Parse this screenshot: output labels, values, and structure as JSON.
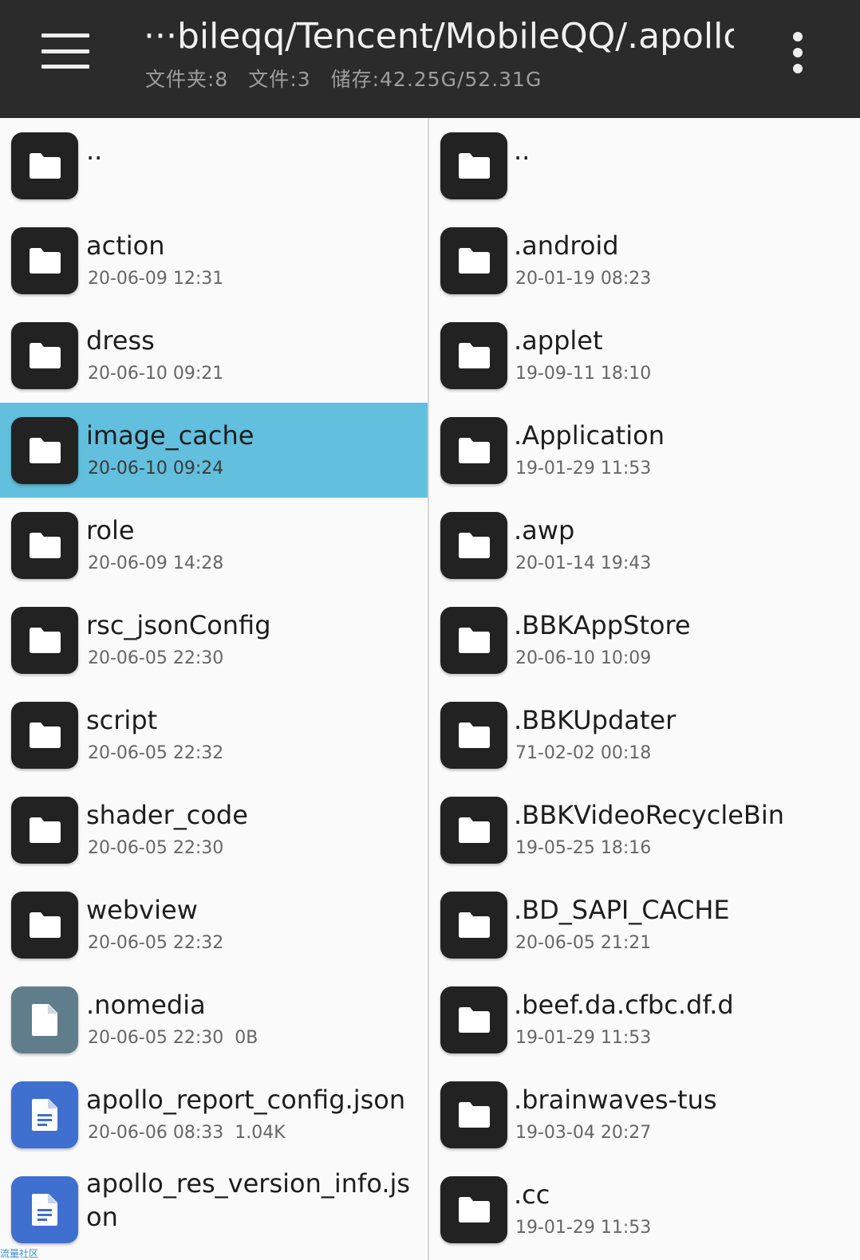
{
  "header": {
    "path": "···bileqq/Tencent/MobileQQ/.apollo/",
    "folders_label": "文件夹:8",
    "files_label": "文件:3",
    "storage_label": "储存:42.25G/52.31G"
  },
  "left_pane": {
    "items": [
      {
        "name": "..",
        "date": "",
        "size": "",
        "kind": "folder"
      },
      {
        "name": "action",
        "date": "20-06-09 12:31",
        "size": "",
        "kind": "folder"
      },
      {
        "name": "dress",
        "date": "20-06-10 09:21",
        "size": "",
        "kind": "folder"
      },
      {
        "name": "image_cache",
        "date": "20-06-10 09:24",
        "size": "",
        "kind": "folder",
        "selected": true
      },
      {
        "name": "role",
        "date": "20-06-09 14:28",
        "size": "",
        "kind": "folder"
      },
      {
        "name": "rsc_jsonConfig",
        "date": "20-06-05 22:30",
        "size": "",
        "kind": "folder"
      },
      {
        "name": "script",
        "date": "20-06-05 22:32",
        "size": "",
        "kind": "folder"
      },
      {
        "name": "shader_code",
        "date": "20-06-05 22:30",
        "size": "",
        "kind": "folder"
      },
      {
        "name": "webview",
        "date": "20-06-05 22:32",
        "size": "",
        "kind": "folder"
      },
      {
        "name": ".nomedia",
        "date": "20-06-05 22:30",
        "size": "0B",
        "kind": "file"
      },
      {
        "name": "apollo_report_config.json",
        "date": "20-06-06 08:33",
        "size": "1.04K",
        "kind": "doc"
      },
      {
        "name": "apollo_res_version_info.json",
        "date": "",
        "size": "",
        "kind": "doc"
      }
    ]
  },
  "right_pane": {
    "items": [
      {
        "name": "..",
        "date": "",
        "kind": "folder"
      },
      {
        "name": ".android",
        "date": "20-01-19 08:23",
        "kind": "folder"
      },
      {
        "name": ".applet",
        "date": "19-09-11 18:10",
        "kind": "folder"
      },
      {
        "name": ".Application",
        "date": "19-01-29 11:53",
        "kind": "folder"
      },
      {
        "name": ".awp",
        "date": "20-01-14 19:43",
        "kind": "folder"
      },
      {
        "name": ".BBKAppStore",
        "date": "20-06-10 10:09",
        "kind": "folder"
      },
      {
        "name": ".BBKUpdater",
        "date": "71-02-02 00:18",
        "kind": "folder"
      },
      {
        "name": ".BBKVideoRecycleBin",
        "date": "19-05-25 18:16",
        "kind": "folder"
      },
      {
        "name": ".BD_SAPI_CACHE",
        "date": "20-06-05 21:21",
        "kind": "folder"
      },
      {
        "name": ".beef.da.cfbc.df.d",
        "date": "19-01-29 11:53",
        "kind": "folder"
      },
      {
        "name": ".brainwaves-tus",
        "date": "19-03-04 20:27",
        "kind": "folder"
      },
      {
        "name": ".cc",
        "date": "19-01-29 11:53",
        "kind": "folder"
      }
    ]
  },
  "icons": {
    "folder": "folder-icon",
    "file": "file-icon",
    "doc": "document-icon",
    "menu": "hamburger-menu-icon",
    "more": "more-vert-icon"
  },
  "colors": {
    "appbar": "#2b2b2b",
    "selected_row": "#62bfdd",
    "folder_icon_bg": "#222222",
    "file_icon_bg": "#607d8b",
    "doc_icon_bg": "#3f6fcf"
  }
}
